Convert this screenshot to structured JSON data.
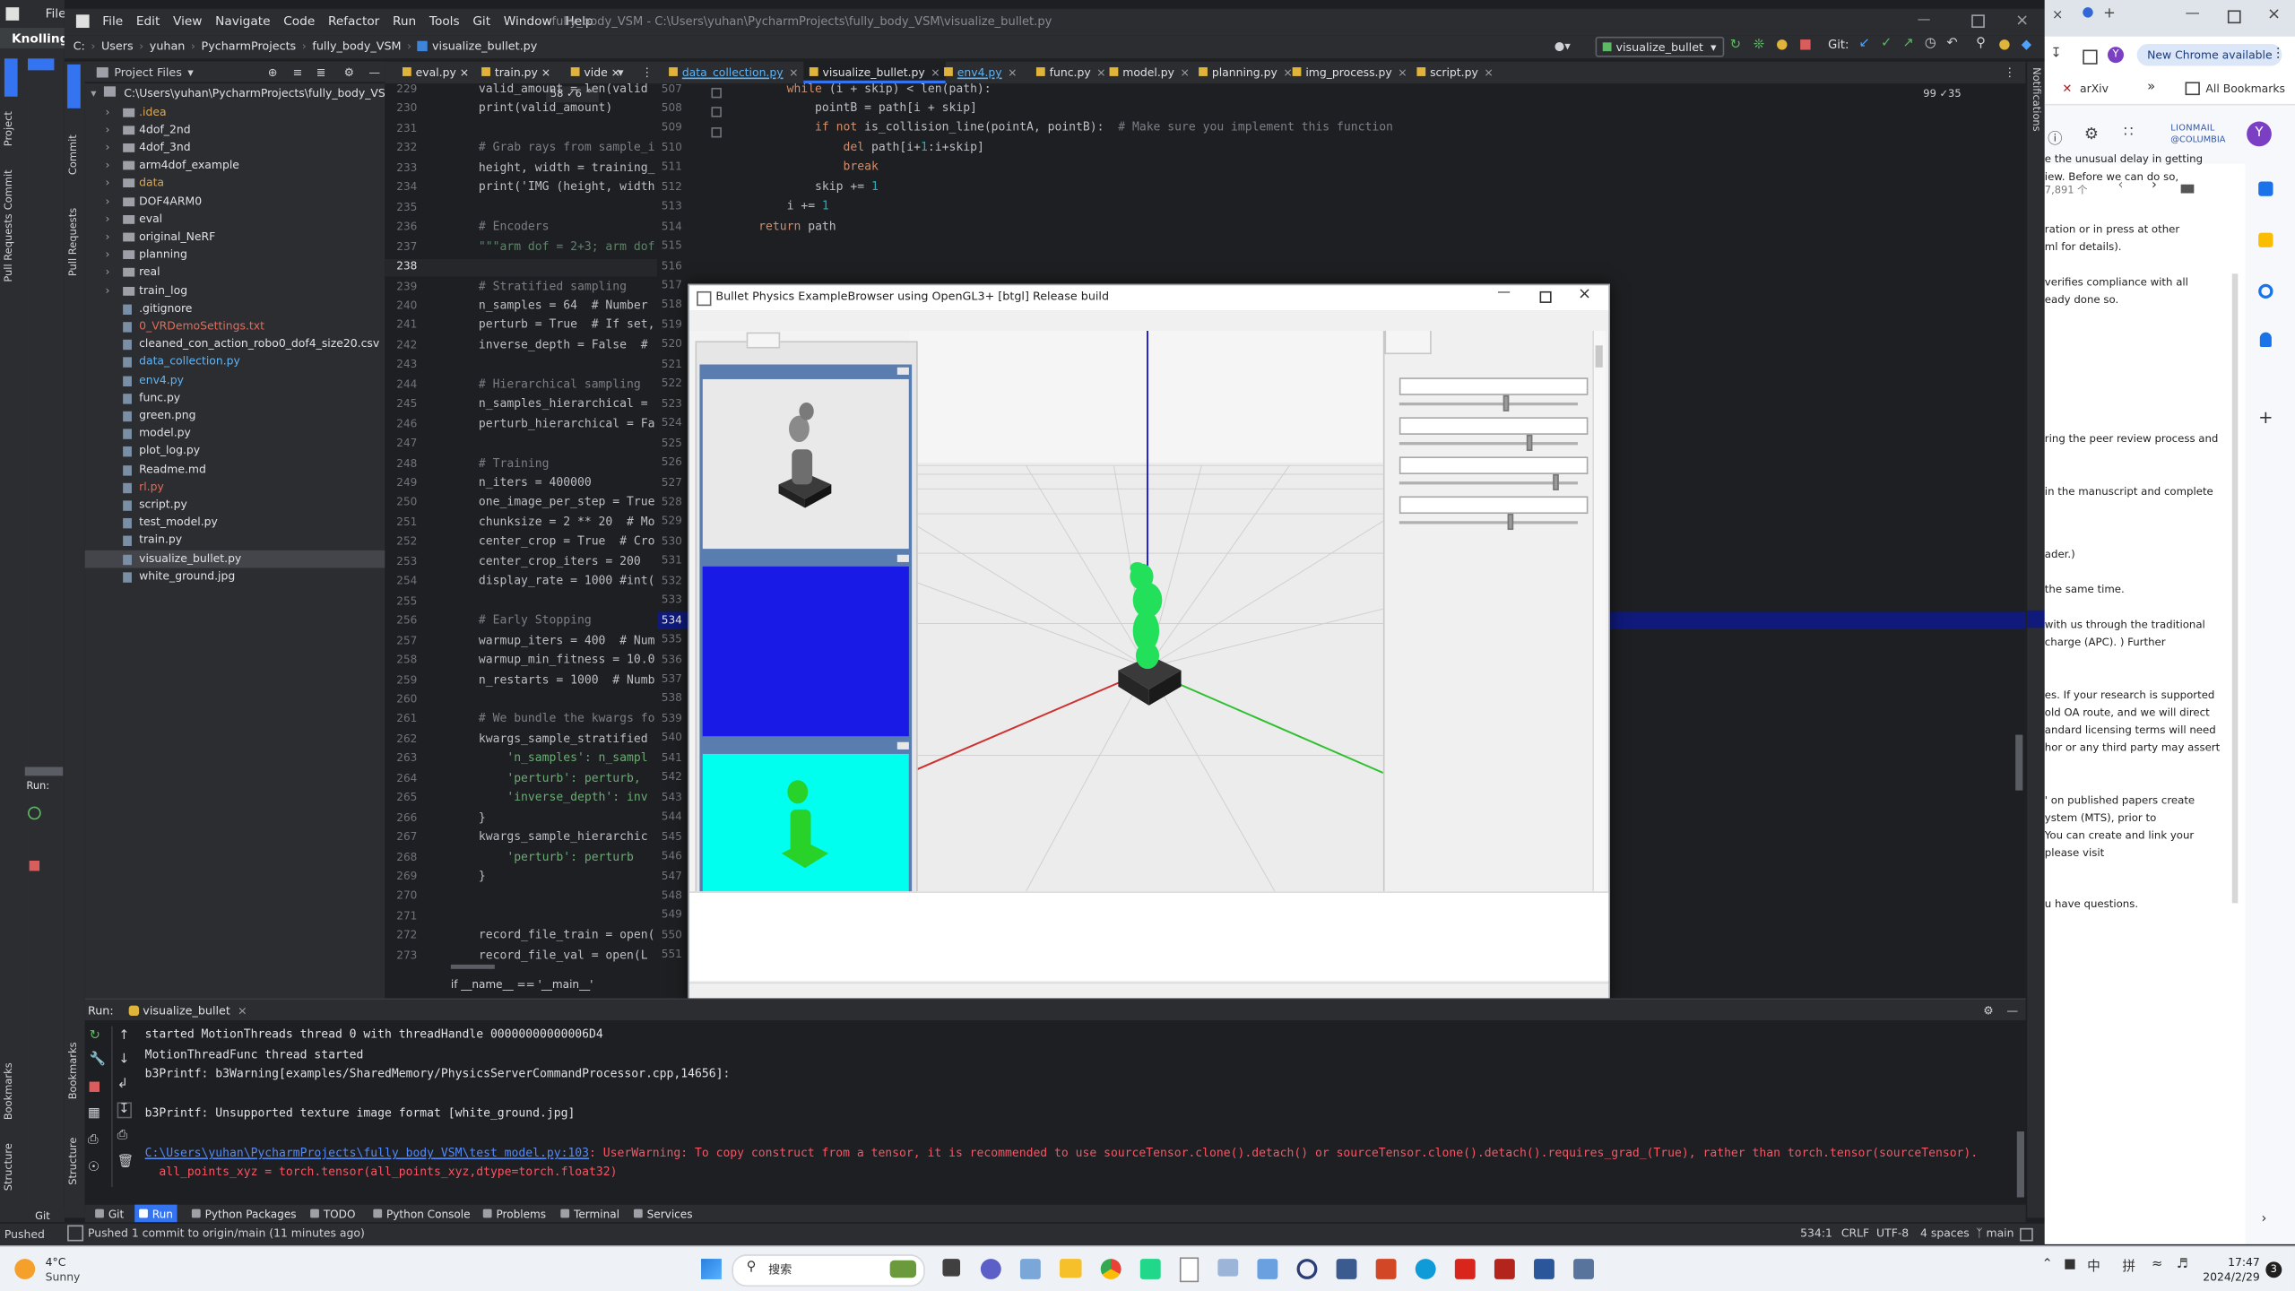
{
  "window": {
    "app_badge": "Knolling",
    "behind_menu_file": "File",
    "menus": [
      "File",
      "Edit",
      "View",
      "Navigate",
      "Code",
      "Refactor",
      "Run",
      "Tools",
      "Git",
      "Window",
      "Help"
    ],
    "title": "fully_body_VSM - C:\\Users\\yuhan\\PycharmProjects\\fully_body_VSM\\visualize_bullet.py"
  },
  "breadcrumb": [
    "C:",
    "Users",
    "yuhan",
    "PycharmProjects",
    "fully_body_VSM",
    "visualize_bullet.py"
  ],
  "run_config": "visualize_bullet",
  "git_label": "Git:",
  "project_panel": {
    "title": "Project Files",
    "root": "C:\\Users\\yuhan\\PycharmProjects\\fully_body_VSM",
    "items": [
      {
        "name": ".idea",
        "type": "folder",
        "color": "#d8a85a"
      },
      {
        "name": "4dof_2nd",
        "type": "folder",
        "color": "#dfe1e5"
      },
      {
        "name": "4dof_3nd",
        "type": "folder",
        "color": "#dfe1e5"
      },
      {
        "name": "arm4dof_example",
        "type": "folder",
        "color": "#dfe1e5"
      },
      {
        "name": "data",
        "type": "folder",
        "color": "#d8a85a"
      },
      {
        "name": "DOF4ARM0",
        "type": "folder",
        "color": "#dfe1e5"
      },
      {
        "name": "eval",
        "type": "folder",
        "color": "#dfe1e5"
      },
      {
        "name": "original_NeRF",
        "type": "folder",
        "color": "#dfe1e5"
      },
      {
        "name": "planning",
        "type": "folder",
        "color": "#dfe1e5"
      },
      {
        "name": "real",
        "type": "folder",
        "color": "#dfe1e5"
      },
      {
        "name": "train_log",
        "type": "folder",
        "color": "#dfe1e5"
      },
      {
        "name": ".gitignore",
        "type": "file",
        "color": "#dfe1e5"
      },
      {
        "name": "0_VRDemoSettings.txt",
        "type": "file",
        "color": "#e06c5a"
      },
      {
        "name": "cleaned_con_action_robo0_dof4_size20.csv",
        "type": "file",
        "color": "#dfe1e5"
      },
      {
        "name": "data_collection.py",
        "type": "file",
        "color": "#5fb4f5"
      },
      {
        "name": "env4.py",
        "type": "file",
        "color": "#5fb4f5"
      },
      {
        "name": "func.py",
        "type": "file",
        "color": "#dfe1e5"
      },
      {
        "name": "green.png",
        "type": "file",
        "color": "#dfe1e5"
      },
      {
        "name": "model.py",
        "type": "file",
        "color": "#dfe1e5"
      },
      {
        "name": "plot_log.py",
        "type": "file",
        "color": "#dfe1e5"
      },
      {
        "name": "Readme.md",
        "type": "file",
        "color": "#dfe1e5"
      },
      {
        "name": "rl.py",
        "type": "file",
        "color": "#e06c5a"
      },
      {
        "name": "script.py",
        "type": "file",
        "color": "#dfe1e5"
      },
      {
        "name": "test_model.py",
        "type": "file",
        "color": "#dfe1e5"
      },
      {
        "name": "train.py",
        "type": "file",
        "color": "#dfe1e5"
      },
      {
        "name": "visualize_bullet.py",
        "type": "file",
        "color": "#dfe1e5"
      },
      {
        "name": "white_ground.jpg",
        "type": "file",
        "color": "#dfe1e5"
      }
    ]
  },
  "left_tabs": [
    "eval.py",
    "train.py",
    "vide"
  ],
  "left_editor": {
    "indicator": "58 ✓6 ^",
    "lines": [
      {
        "n": "229",
        "t": "valid_amount = len(valid"
      },
      {
        "n": "230",
        "t": "print(valid_amount)"
      },
      {
        "n": "231",
        "t": ""
      },
      {
        "n": "232",
        "t": "# Grab rays from sample_i"
      },
      {
        "n": "233",
        "t": "height, width = training_"
      },
      {
        "n": "234",
        "t": "print('IMG (height, width"
      },
      {
        "n": "235",
        "t": ""
      },
      {
        "n": "236",
        "t": "# Encoders"
      },
      {
        "n": "237",
        "t": "\"\"\"arm dof = 2+3; arm dof"
      },
      {
        "n": "238",
        "t": ""
      },
      {
        "n": "239",
        "t": "# Stratified sampling"
      },
      {
        "n": "240",
        "t": "n_samples = 64  # Number"
      },
      {
        "n": "241",
        "t": "perturb = True  # If set,"
      },
      {
        "n": "242",
        "t": "inverse_depth = False  #"
      },
      {
        "n": "243",
        "t": ""
      },
      {
        "n": "244",
        "t": "# Hierarchical sampling"
      },
      {
        "n": "245",
        "t": "n_samples_hierarchical ="
      },
      {
        "n": "246",
        "t": "perturb_hierarchical = Fa"
      },
      {
        "n": "247",
        "t": ""
      },
      {
        "n": "248",
        "t": "# Training"
      },
      {
        "n": "249",
        "t": "n_iters = 400000"
      },
      {
        "n": "250",
        "t": "one_image_per_step = True"
      },
      {
        "n": "251",
        "t": "chunksize = 2 ** 20  # Mo"
      },
      {
        "n": "252",
        "t": "center_crop = True  # Cro"
      },
      {
        "n": "253",
        "t": "center_crop_iters = 200"
      },
      {
        "n": "254",
        "t": "display_rate = 1000 #int("
      },
      {
        "n": "255",
        "t": ""
      },
      {
        "n": "256",
        "t": "# Early Stopping"
      },
      {
        "n": "257",
        "t": "warmup_iters = 400  # Num"
      },
      {
        "n": "258",
        "t": "warmup_min_fitness = 10.0"
      },
      {
        "n": "259",
        "t": "n_restarts = 1000  # Numb"
      },
      {
        "n": "260",
        "t": ""
      },
      {
        "n": "261",
        "t": "# We bundle the kwargs fo"
      },
      {
        "n": "262",
        "t": "kwargs_sample_stratified"
      },
      {
        "n": "263",
        "t": "    'n_samples': n_sampl"
      },
      {
        "n": "264",
        "t": "    'perturb': perturb,"
      },
      {
        "n": "265",
        "t": "    'inverse_depth': inv"
      },
      {
        "n": "266",
        "t": "}"
      },
      {
        "n": "267",
        "t": "kwargs_sample_hierarchic"
      },
      {
        "n": "268",
        "t": "    'perturb': perturb"
      },
      {
        "n": "269",
        "t": "}"
      },
      {
        "n": "270",
        "t": ""
      },
      {
        "n": "271",
        "t": ""
      },
      {
        "n": "272",
        "t": "record_file_train = open("
      },
      {
        "n": "273",
        "t": "record_file_val = open(L"
      }
    ],
    "bottom_crumb": "if __name__ == '__main__'"
  },
  "right_tabs": [
    "data_collection.py",
    "visualize_bullet.py",
    "env4.py",
    "func.py",
    "model.py",
    "planning.py",
    "img_process.py",
    "script.py"
  ],
  "right_editor": {
    "indicator": "99  ✓35",
    "lines": [
      {
        "n": "507",
        "t": "        while (i + skip) < len(path):"
      },
      {
        "n": "508",
        "t": "            pointB = path[i + skip]"
      },
      {
        "n": "509",
        "t": "            if not is_collision_line(pointA, pointB):  # Make sure you implement this function"
      },
      {
        "n": "510",
        "t": "                del path[i+1:i+skip]"
      },
      {
        "n": "511",
        "t": "                break"
      },
      {
        "n": "512",
        "t": "            skip += 1"
      },
      {
        "n": "513",
        "t": "        i += 1"
      },
      {
        "n": "514",
        "t": "    return path"
      }
    ],
    "more_line_numbers": [
      "515",
      "516",
      "517",
      "518",
      "519",
      "520",
      "521",
      "522",
      "523",
      "524",
      "525",
      "526",
      "527",
      "528",
      "529",
      "530",
      "531",
      "532",
      "533",
      "534",
      "535",
      "536",
      "537",
      "538",
      "539",
      "540",
      "541",
      "542",
      "543",
      "544",
      "545",
      "546",
      "547",
      "548",
      "549",
      "550",
      "551"
    ]
  },
  "bullet_window": {
    "title": "Bullet Physics ExampleBrowser using OpenGL3+ [btgl] Release build",
    "slider_levels": [
      0.6,
      0.73,
      0.88,
      0.62
    ]
  },
  "run_panel": {
    "label": "Run:",
    "tab": "visualize_bullet",
    "output": [
      {
        "text": "started MotionThreads thread 0 with threadHandle 00000000000006D4",
        "color": "#dfe1e5"
      },
      {
        "text": "MotionThreadFunc thread started",
        "color": "#dfe1e5"
      },
      {
        "text": "b3Printf: b3Warning[examples/SharedMemory/PhysicsServerCommandProcessor.cpp,14656]:",
        "color": "#dfe1e5"
      },
      {
        "text": "",
        "color": "#dfe1e5"
      },
      {
        "text": "b3Printf: Unsupported texture image format [white_ground.jpg]",
        "color": "#dfe1e5"
      },
      {
        "text": "",
        "color": "#dfe1e5"
      },
      {
        "text": "",
        "color": "#dfe1e5"
      }
    ],
    "warning_link": "C:\\Users\\yuhan\\PycharmProjects\\fully_body_VSM\\test_model.py:103",
    "warning_text": ": UserWarning: To copy construct from a tensor, it is recommended to use sourceTensor.clone().detach() or sourceTensor.clone().detach().requires_grad_(True), rather than torch.tensor(sourceTensor).",
    "warning_line2": "  all_points_xyz = torch.tensor(all_points_xyz,dtype=torch.float32)"
  },
  "bottom_tabs": [
    "Git",
    "Run",
    "Python Packages",
    "TODO",
    "Python Console",
    "Problems",
    "Terminal",
    "Services"
  ],
  "status_bar": {
    "message": "Pushed 1 commit to origin/main (11 minutes ago)",
    "left_label": "Pushed",
    "position": "534:1",
    "line_sep": "CRLF",
    "encoding": "UTF-8",
    "indent": "4 spaces",
    "branch": "main"
  },
  "side_labels": {
    "project": "Project",
    "commit": "Commit",
    "pull_requests": "Pull Requests",
    "bookmarks": "Bookmarks",
    "structure": "Structure",
    "notifications": "Notifications",
    "run": "Run:",
    "git": "Git"
  },
  "chrome": {
    "update_button": "New Chrome available",
    "bookmarks": [
      "arXiv",
      "All Bookmarks"
    ],
    "logo_line1": "LIONMAIL",
    "logo_line2": "@COLUMBIA",
    "avatar": "Y",
    "counter": "7,891 个",
    "paragraphs": [
      "e the unusual delay in getting",
      "iew. Before we can do so,",
      "ration or in press at other",
      "ml for details).",
      "verifies compliance with all",
      "eady done so.",
      "ring the peer review process and",
      "in the manuscript and complete",
      "ader.)",
      "the same time.",
      "with us through the traditional",
      "charge (APC). ) Further",
      "es. If your research is supported",
      "old OA route, and we will direct",
      "andard licensing terms will need",
      "hor or any third party may assert",
      "' on published papers create",
      "ystem (MTS), prior to",
      "You can create and link your",
      "please visit",
      "u have questions."
    ]
  },
  "taskbar": {
    "weather_temp": "4°C",
    "weather_desc": "Sunny",
    "search": "搜索",
    "ime1": "中",
    "ime2": "拼",
    "time": "17:47",
    "date": "2024/2/29",
    "notif_count": "3"
  }
}
